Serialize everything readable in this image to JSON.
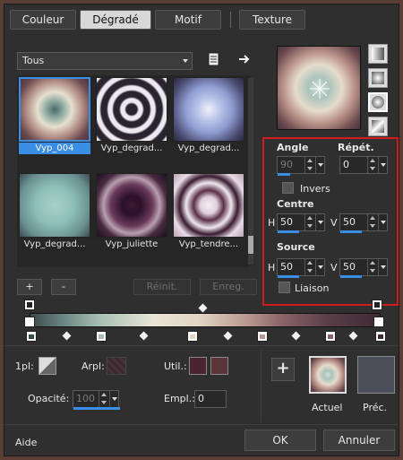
{
  "tabs": [
    {
      "label": "Couleur",
      "active": false
    },
    {
      "label": "Dégradé",
      "active": true
    },
    {
      "label": "Motif",
      "active": false
    },
    {
      "label": "Texture",
      "active": false
    }
  ],
  "library": {
    "category": "Tous",
    "items": [
      {
        "label": "Vyp_004",
        "selected": true
      },
      {
        "label": "Vyp_degrad...",
        "selected": false
      },
      {
        "label": "Vyp_degrad...",
        "selected": false
      },
      {
        "label": "Vyp_degrad...",
        "selected": false
      },
      {
        "label": "Vyp_juliette",
        "selected": false
      },
      {
        "label": "Vyp_tendre...",
        "selected": false
      }
    ],
    "add_label": "+",
    "remove_label": "-",
    "reset_label": "Réinit.",
    "save_label": "Enreg."
  },
  "params": {
    "angle_label": "Angle",
    "angle_value": "90",
    "repeat_label": "Répét.",
    "repeat_value": "0",
    "invert_label": "Invers",
    "center_label": "Centre",
    "center_h_label": "H",
    "center_h_value": "50",
    "center_v_label": "V",
    "center_v_value": "50",
    "source_label": "Source",
    "source_h_label": "H",
    "source_h_value": "50",
    "source_v_label": "V",
    "source_v_value": "50",
    "link_label": "Liaison"
  },
  "editor": {
    "pl_label": "1pl:",
    "arpl_label": "Arpl:",
    "util_label": "Util.:",
    "opacity_label": "Opacité:",
    "opacity_value": "100",
    "location_label": "Empl.:",
    "location_value": "0",
    "util_color_1": "#4a2430",
    "util_color_2": "#5a3438"
  },
  "preview": {
    "current_label": "Actuel",
    "previous_label": "Préc.",
    "add_label": "+",
    "previous_color": "#4a4e58"
  },
  "footer": {
    "help_label": "Aide",
    "ok_label": "OK",
    "cancel_label": "Annuler"
  },
  "colors": {
    "accent": "#3a8ee6",
    "highlight_box": "#d21c1c"
  }
}
